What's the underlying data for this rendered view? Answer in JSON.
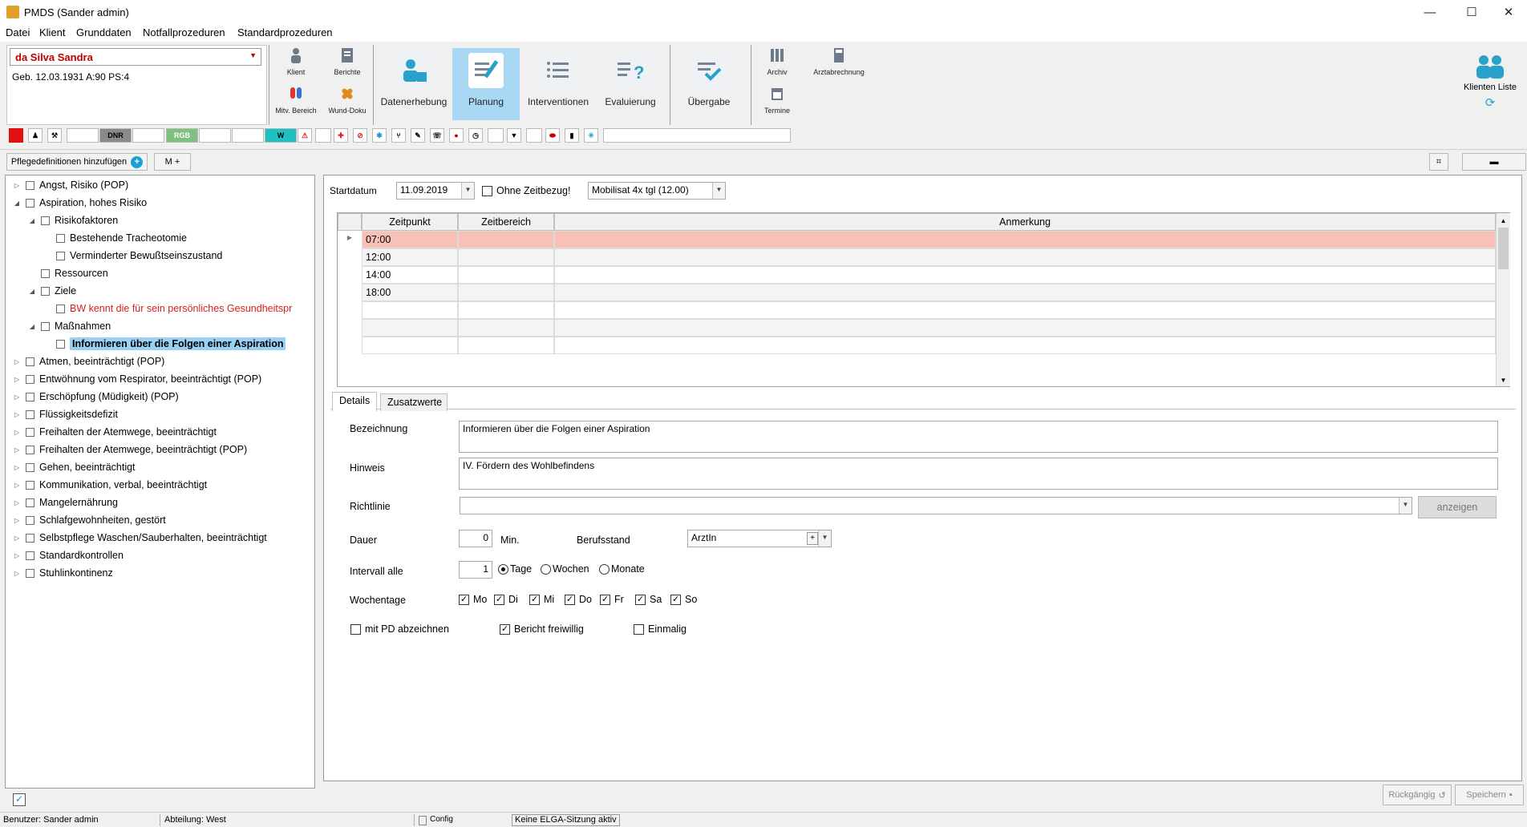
{
  "window": {
    "title": "PMDS (Sander admin)",
    "minimize": "—",
    "maximize": "☐",
    "close": "✕"
  },
  "menu": [
    "Datei",
    "Klient",
    "Grunddaten",
    "Notfallprozeduren",
    "Standardprozeduren"
  ],
  "patient": {
    "name": "da Silva Sandra",
    "info": "Geb. 12.03.1931   A:90   PS:4"
  },
  "ribbon": {
    "small": [
      {
        "label": "Klient",
        "icon": "person-icon"
      },
      {
        "label": "Berichte",
        "icon": "report-icon"
      },
      {
        "label": "Mitv. Bereich",
        "icon": "pills-icon"
      },
      {
        "label": "Wund-Doku",
        "icon": "bandage-icon"
      }
    ],
    "big": [
      {
        "label": "Datenerhebung",
        "icon": "data-collection-icon"
      },
      {
        "label": "Planung",
        "icon": "planning-icon"
      },
      {
        "label": "Interventionen",
        "icon": "list-icon"
      },
      {
        "label": "Evaluierung",
        "icon": "evaluation-icon"
      },
      {
        "label": "Übergabe",
        "icon": "handover-icon"
      }
    ],
    "extra": [
      {
        "label": "Archiv"
      },
      {
        "label": "Arztabrechnung"
      },
      {
        "label": "Termine"
      }
    ],
    "klienten_liste": "Klienten Liste"
  },
  "iconbar": {
    "dnr": "DNR",
    "rgb": "RGB",
    "w": "W"
  },
  "toolbar": {
    "add_label": "Pflegedefinitionen hinzufügen",
    "m_plus": "M +"
  },
  "tree": [
    {
      "label": "Angst, Risiko (POP)",
      "level": 0,
      "exp": "▷"
    },
    {
      "label": "Aspiration, hohes Risiko",
      "level": 0,
      "exp": "◢"
    },
    {
      "label": "Risikofaktoren",
      "level": 1,
      "exp": "◢"
    },
    {
      "label": "Bestehende Tracheotomie",
      "level": 2,
      "exp": ""
    },
    {
      "label": "Verminderter Bewußtseinszustand",
      "level": 2,
      "exp": ""
    },
    {
      "label": "Ressourcen",
      "level": 1,
      "exp": ""
    },
    {
      "label": "Ziele",
      "level": 1,
      "exp": "◢"
    },
    {
      "label": "BW kennt die für sein persönliches Gesundheitspr",
      "level": 2,
      "exp": "",
      "red": true
    },
    {
      "label": "Maßnahmen",
      "level": 1,
      "exp": "◢"
    },
    {
      "label": "Informieren über die Folgen einer Aspiration",
      "level": 2,
      "exp": "",
      "selected": true
    },
    {
      "label": "Atmen, beeinträchtigt (POP)",
      "level": 0,
      "exp": "▷"
    },
    {
      "label": "Entwöhnung vom Respirator, beeinträchtigt (POP)",
      "level": 0,
      "exp": "▷"
    },
    {
      "label": "Erschöpfung (Müdigkeit) (POP)",
      "level": 0,
      "exp": "▷"
    },
    {
      "label": "Flüssigkeitsdefizit",
      "level": 0,
      "exp": "▷"
    },
    {
      "label": "Freihalten der Atemwege, beeinträchtigt",
      "level": 0,
      "exp": "▷"
    },
    {
      "label": "Freihalten der Atemwege, beeinträchtigt (POP)",
      "level": 0,
      "exp": "▷"
    },
    {
      "label": "Gehen, beeinträchtigt",
      "level": 0,
      "exp": "▷"
    },
    {
      "label": "Kommunikation, verbal, beeinträchtigt",
      "level": 0,
      "exp": "▷"
    },
    {
      "label": "Mangelernährung",
      "level": 0,
      "exp": "▷"
    },
    {
      "label": "Schlafgewohnheiten, gestört",
      "level": 0,
      "exp": "▷"
    },
    {
      "label": "Selbstpflege Waschen/Sauberhalten, beeinträchtigt",
      "level": 0,
      "exp": "▷"
    },
    {
      "label": "Standardkontrollen",
      "level": 0,
      "exp": "▷"
    },
    {
      "label": "Stuhlinkontinenz",
      "level": 0,
      "exp": "▷"
    }
  ],
  "form": {
    "startdatum_label": "Startdatum",
    "startdatum": "11.09.2019",
    "ohne_zeitbezug": "Ohne Zeitbezug!",
    "mobilisat": "Mobilisat  4x tgl (12.00)",
    "grid": {
      "headers": [
        "Zeitpunkt",
        "Zeitbereich",
        "Anmerkung"
      ],
      "rows": [
        "07:00",
        "12:00",
        "14:00",
        "18:00",
        "",
        "",
        ""
      ]
    },
    "tabs": [
      "Details",
      "Zusatzwerte"
    ],
    "bezeichnung_label": "Bezeichnung",
    "bezeichnung": "Informieren über die Folgen einer Aspiration",
    "hinweis_label": "Hinweis",
    "hinweis": "IV. Fördern des Wohlbefindens",
    "richtlinie_label": "Richtlinie",
    "anzeigen": "anzeigen",
    "dauer_label": "Dauer",
    "dauer": "0",
    "min": "Min.",
    "berufsstand_label": "Berufsstand",
    "berufsstand": "ArztIn",
    "intervall_label": "Intervall alle",
    "intervall": "1",
    "intervall_units": [
      {
        "label": "Tage",
        "on": true
      },
      {
        "label": "Wochen",
        "on": false
      },
      {
        "label": "Monate",
        "on": false
      }
    ],
    "wochentage_label": "Wochentage",
    "days": [
      "Mo",
      "Di",
      "Mi",
      "Do",
      "Fr",
      "Sa",
      "So"
    ],
    "mit_pd": "mit PD abzeichnen",
    "bericht": "Bericht freiwillig",
    "einmalig": "Einmalig"
  },
  "bottom": {
    "rueckgaengig": "Rückgängig",
    "speichern": "Speichern"
  },
  "status": {
    "benutzer": "Benutzer: Sander admin",
    "abteilung": "Abteilung: West",
    "config": "Config",
    "elga": "Keine ELGA-Sitzung aktiv"
  }
}
